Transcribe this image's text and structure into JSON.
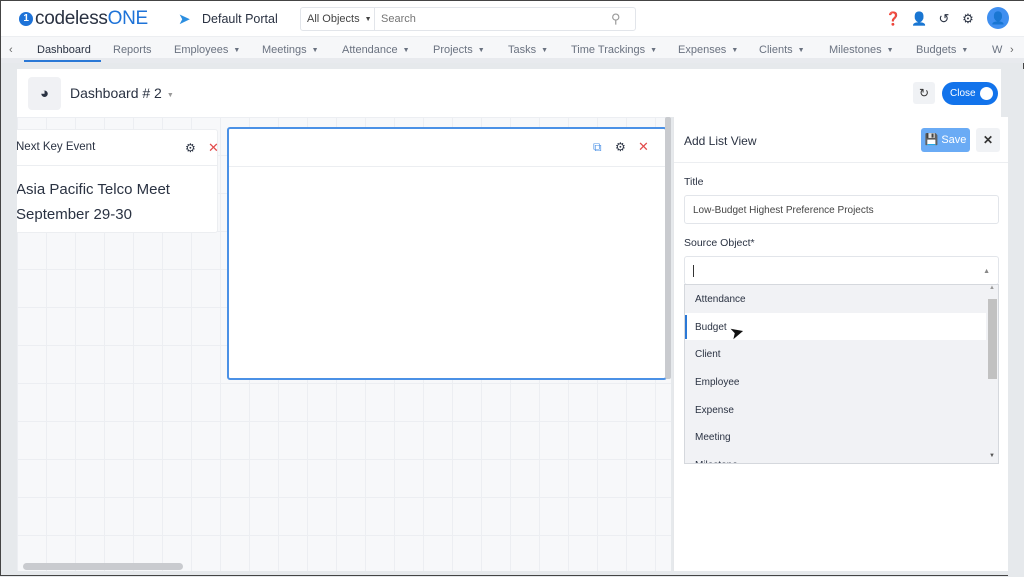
{
  "app": {
    "logo_prefix": "1",
    "logo_text": "codeless",
    "logo_accent": "ONE",
    "portal": "Default Portal"
  },
  "search": {
    "scope": "All Objects",
    "placeholder": "Search"
  },
  "top_icons": [
    "help-icon",
    "add-user-icon",
    "history-icon",
    "gear-icon",
    "avatar-icon"
  ],
  "nav": {
    "items": [
      {
        "label": "Dashboard",
        "dropdown": false
      },
      {
        "label": "Reports",
        "dropdown": false
      },
      {
        "label": "Employees",
        "dropdown": true
      },
      {
        "label": "Meetings",
        "dropdown": true
      },
      {
        "label": "Attendance",
        "dropdown": true
      },
      {
        "label": "Projects",
        "dropdown": true
      },
      {
        "label": "Tasks",
        "dropdown": true
      },
      {
        "label": "Time Trackings",
        "dropdown": true
      },
      {
        "label": "Expenses",
        "dropdown": true
      },
      {
        "label": "Clients",
        "dropdown": true
      },
      {
        "label": "Milestones",
        "dropdown": true
      },
      {
        "label": "Budgets",
        "dropdown": true
      },
      {
        "label": "W",
        "dropdown": false
      }
    ],
    "active": "Dashboard"
  },
  "dashboard": {
    "title": "Dashboard # 2",
    "toggle_label": "Close"
  },
  "widgets": {
    "event": {
      "title": "Next Key Event",
      "line1": "Asia Pacific Telco Meet",
      "line2": "September 29-30"
    }
  },
  "panel": {
    "title": "Add List View",
    "save": "Save",
    "title_label": "Title",
    "title_value": "Low-Budget Highest Preference Projects",
    "source_label": "Source Object*",
    "source_value": "",
    "options": [
      "Attendance",
      "Budget",
      "Client",
      "Employee",
      "Expense",
      "Meeting",
      "Milestone"
    ],
    "highlighted": "Budget"
  },
  "colors": {
    "accent": "#1273eb",
    "active_border": "#4b91e6",
    "close_red": "#e24b4b",
    "save_bg": "#6aabf5"
  }
}
